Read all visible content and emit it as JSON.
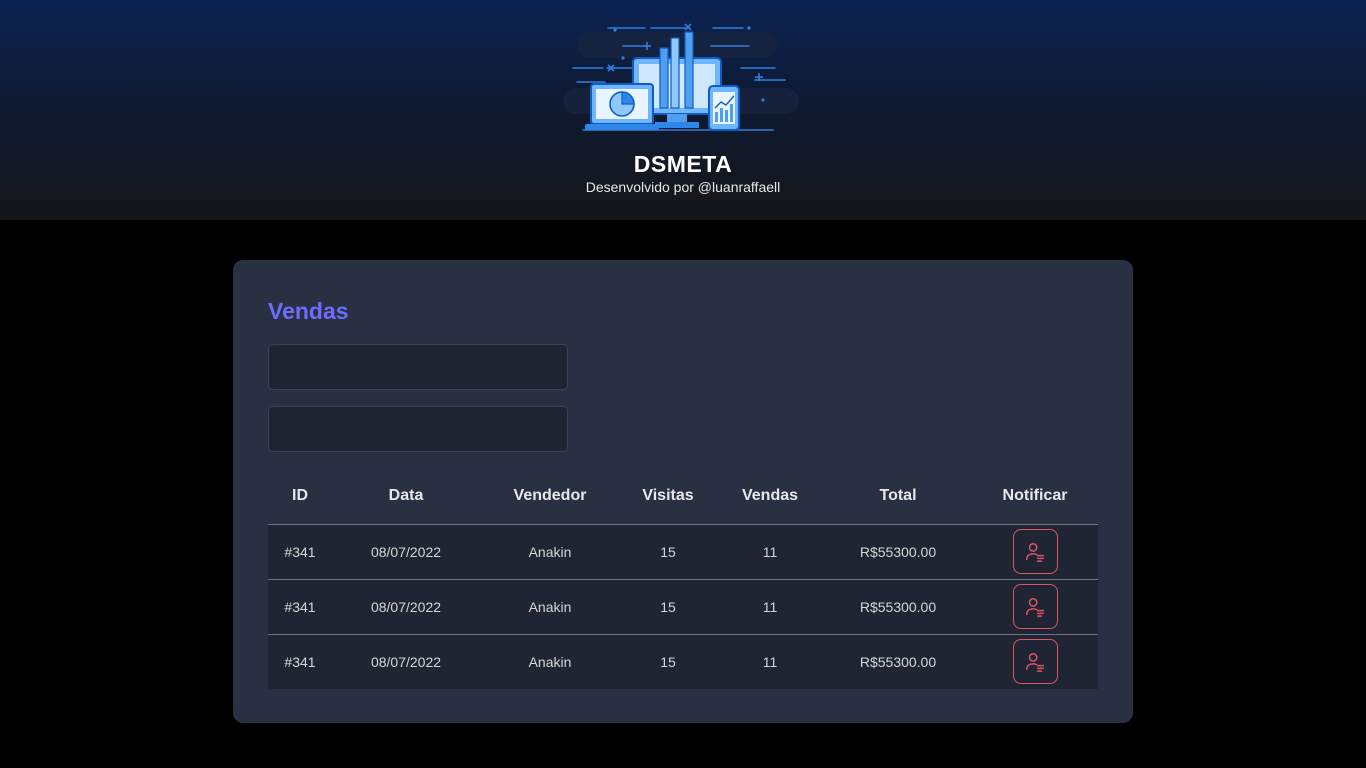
{
  "header": {
    "title": "DSMETA",
    "subtitle": "Desenvolvido por @luanraffaell",
    "logo_icon": "analytics-devices-logo"
  },
  "sales": {
    "title": "Vendas",
    "date_inputs": [
      {
        "value": "",
        "placeholder": ""
      },
      {
        "value": "",
        "placeholder": ""
      }
    ],
    "columns": [
      "ID",
      "Data",
      "Vendedor",
      "Visitas",
      "Vendas",
      "Total",
      "Notificar"
    ],
    "rows": [
      {
        "id": "#341",
        "date": "08/07/2022",
        "seller": "Anakin",
        "visits": "15",
        "deals": "11",
        "total": "R$55300.00"
      },
      {
        "id": "#341",
        "date": "08/07/2022",
        "seller": "Anakin",
        "visits": "15",
        "deals": "11",
        "total": "R$55300.00"
      },
      {
        "id": "#341",
        "date": "08/07/2022",
        "seller": "Anakin",
        "visits": "15",
        "deals": "11",
        "total": "R$55300.00"
      }
    ],
    "notify_icon": "user-notify-icon"
  },
  "colors": {
    "accent": "#6c6cff",
    "notify": "#e05468",
    "card_bg": "#283042",
    "row_bg": "#1f2533"
  }
}
